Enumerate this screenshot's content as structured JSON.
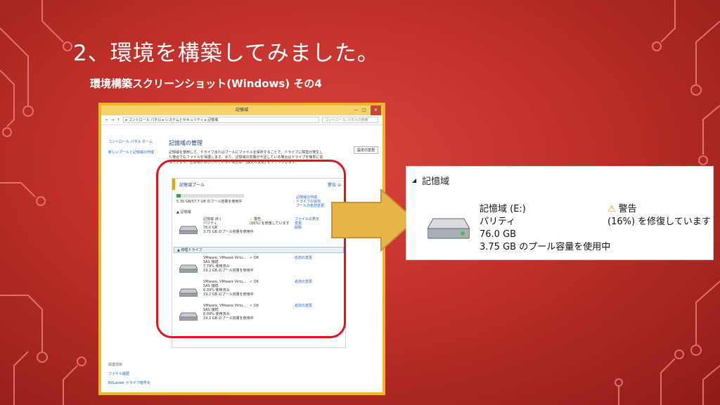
{
  "slide": {
    "title": "2、環境を構築してみました。",
    "subtitle": "環境構築スクリーンショット(Windows) その4"
  },
  "window": {
    "title": "記憶域",
    "controls": [
      "—",
      "□",
      "✕"
    ],
    "address": "▸ コントロール パネル ▸ システムとセキュリティ ▸ 記憶域",
    "search_placeholder": "コントロール パネルの検索",
    "left_nav": {
      "home": "コントロール パネル ホーム",
      "create": "新しいプールと記憶域の作成"
    },
    "left_footer": {
      "header": "関連項目",
      "items": [
        "ファイル履歴",
        "BitLocker ドライブ暗号化"
      ]
    },
    "main": {
      "title": "記憶域の管理",
      "description": "記憶域を使用して、ドライブまたはプールにファイルを保存することで、ドライブに障害が発生した場合でもファイルを保護します。また、記憶域の容量が不足している場合はドライブを簡単に追加できます。記憶域が表示されていない場合は、[設定の変更] をクリックします。",
      "change_button": "設定の変更"
    },
    "pool": {
      "title": "記憶域プール",
      "warn": "警告",
      "usage": "5.30 GB/57.7 GB のプール容量を使用中",
      "links": [
        "記憶域の作成",
        "ドライブの追加",
        "プールの名前変更"
      ],
      "spaces_header": "記憶域",
      "space": {
        "name": "記憶域 (E:)",
        "type": "パリティ",
        "size": "76.0 GB",
        "usage": "3.75 GB のプール容量を使用中",
        "status": "警告",
        "status_detail": "(16%) を修復しています",
        "actions": [
          "ファイルの表示",
          "変更",
          "削除"
        ]
      },
      "drives_header": "物理ドライブ",
      "drives": [
        {
          "name": "VMware, VMware Virtu...",
          "sub": "SAS 接続",
          "pct": "7.79% 使用済み",
          "usage": "19.2 GB のプール容量を使用中",
          "status": "OK",
          "action": "名前の変更"
        },
        {
          "name": "VMware, VMware Virtu...",
          "sub": "SAS 接続",
          "pct": "6.09% 使用済み",
          "usage": "19.2 GB のプール容量を使用中",
          "status": "OK",
          "action": "名前の変更"
        },
        {
          "name": "VMware, VMware Virtu...",
          "sub": "SAS 接続",
          "pct": "6.09% 使用済み",
          "usage": "19.2 GB のプール容量を使用中",
          "status": "OK",
          "action": "名前の変更"
        }
      ]
    }
  },
  "zoom": {
    "header": "記憶域",
    "name": "記憶域 (E:)",
    "type": "パリティ",
    "size": "76.0 GB",
    "usage": "3.75 GB のプール容量を使用中",
    "status": "警告",
    "status_detail": "(16%) を修復しています"
  },
  "colors": {
    "background": "#c0302a",
    "frame": "#f0b429",
    "highlight_ring": "#e0151b",
    "arrow": "#e8b54a",
    "link": "#1a5fb4"
  }
}
